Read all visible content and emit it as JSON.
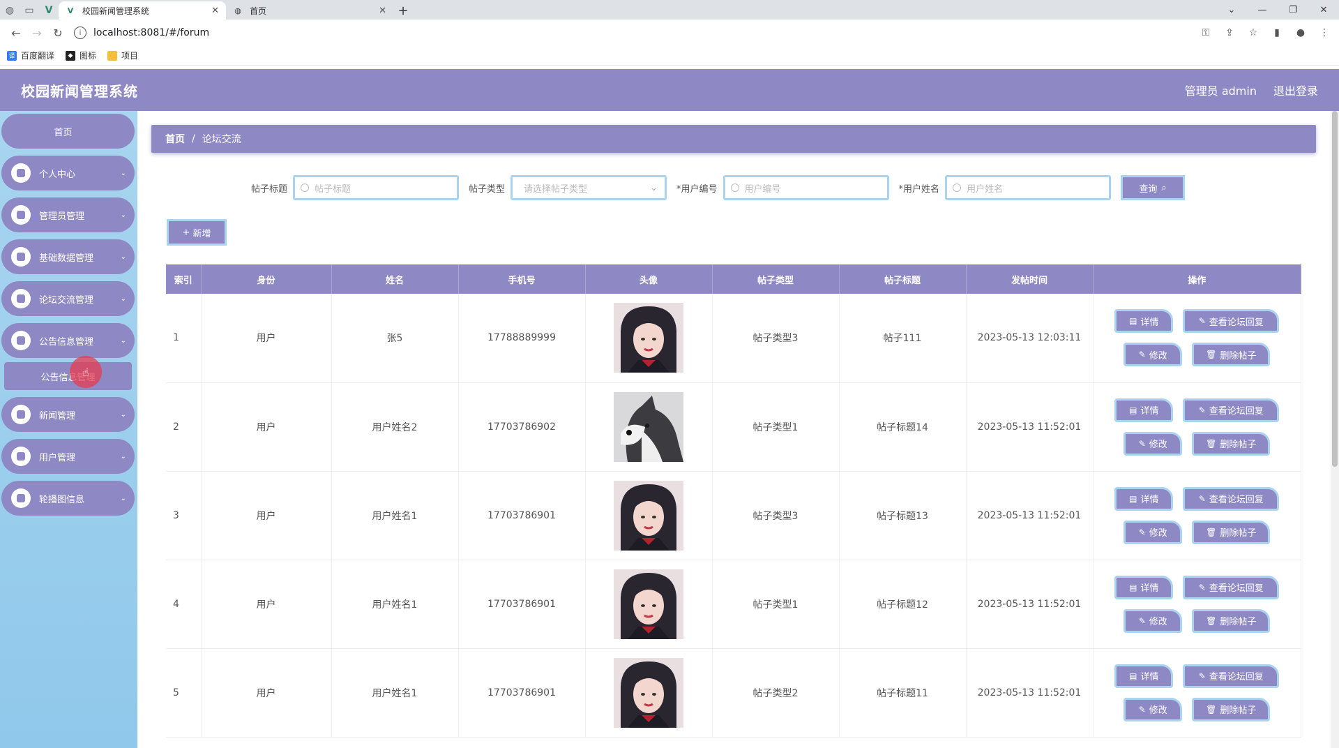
{
  "browser": {
    "tabs": [
      {
        "title": "校园新闻管理系统",
        "active": true
      },
      {
        "title": "首页",
        "active": false
      }
    ],
    "url": "localhost:8081/#/forum",
    "bookmarks": [
      "百度翻译",
      "图标",
      "项目"
    ]
  },
  "app": {
    "title": "校园新闻管理系统",
    "user_label": "管理员 admin",
    "logout": "退出登录"
  },
  "sidebar": {
    "home": "首页",
    "items": [
      {
        "label": "个人中心",
        "icon": "user-icon"
      },
      {
        "label": "管理员管理",
        "icon": "admin-icon"
      },
      {
        "label": "基础数据管理",
        "icon": "clipboard-icon"
      },
      {
        "label": "论坛交流管理",
        "icon": "grid-icon"
      },
      {
        "label": "公告信息管理",
        "icon": "announce-icon"
      },
      {
        "label": "新闻管理",
        "icon": "pin-icon"
      },
      {
        "label": "用户管理",
        "icon": "send-icon"
      },
      {
        "label": "轮播图信息",
        "icon": "user-icon"
      }
    ],
    "submenu": "公告信息管理"
  },
  "breadcrumb": {
    "home": "首页",
    "current": "论坛交流"
  },
  "search": {
    "title_label": "帖子标题",
    "title_placeholder": "帖子标题",
    "type_label": "帖子类型",
    "type_placeholder": "请选择帖子类型",
    "userno_label": "用户编号",
    "userno_placeholder": "用户编号",
    "username_label": "用户姓名",
    "username_placeholder": "用户姓名",
    "query": "查询"
  },
  "add_button": "新增",
  "table": {
    "headers": [
      "索引",
      "身份",
      "姓名",
      "手机号",
      "头像",
      "帖子类型",
      "帖子标题",
      "发帖时间",
      "操作"
    ],
    "rows": [
      {
        "idx": "1",
        "role": "用户",
        "name": "张5",
        "phone": "17788889999",
        "avatar": "girl",
        "type": "帖子类型3",
        "title": "帖子111",
        "time": "2023-05-13 12:03:11"
      },
      {
        "idx": "2",
        "role": "用户",
        "name": "用户姓名2",
        "phone": "17703786902",
        "avatar": "dog",
        "type": "帖子类型1",
        "title": "帖子标题14",
        "time": "2023-05-13 11:52:01"
      },
      {
        "idx": "3",
        "role": "用户",
        "name": "用户姓名1",
        "phone": "17703786901",
        "avatar": "girl",
        "type": "帖子类型3",
        "title": "帖子标题13",
        "time": "2023-05-13 11:52:01"
      },
      {
        "idx": "4",
        "role": "用户",
        "name": "用户姓名1",
        "phone": "17703786901",
        "avatar": "girl",
        "type": "帖子类型1",
        "title": "帖子标题12",
        "time": "2023-05-13 11:52:01"
      },
      {
        "idx": "5",
        "role": "用户",
        "name": "用户姓名1",
        "phone": "17703786901",
        "avatar": "girl",
        "type": "帖子类型2",
        "title": "帖子标题11",
        "time": "2023-05-13 11:52:01"
      }
    ],
    "ops": {
      "detail": "详情",
      "view": "查看论坛回复",
      "edit": "修改",
      "delete": "删除帖子"
    }
  },
  "colors": {
    "primary": "#8e89c4",
    "sidebar": "#a8d5ef",
    "border": "#a9d3ee"
  }
}
